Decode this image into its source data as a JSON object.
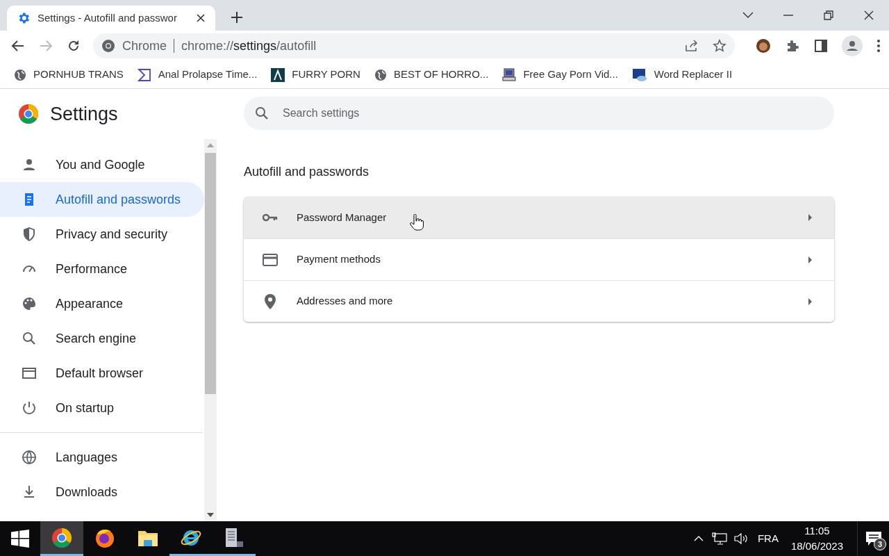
{
  "tab": {
    "title": "Settings - Autofill and passwor",
    "selected": true
  },
  "address_bar": {
    "site_label": "Chrome",
    "url_host": "chrome://",
    "url_path": "settings",
    "url_rest": "/autofill"
  },
  "bookmarks": [
    {
      "label": "PORNHUB TRANS"
    },
    {
      "label": "Anal Prolapse Time..."
    },
    {
      "label": "FURRY PORN"
    },
    {
      "label": "BEST OF HORRO..."
    },
    {
      "label": "Free Gay Porn Vid..."
    },
    {
      "label": "Word Replacer II"
    }
  ],
  "settings_title": "Settings",
  "search": {
    "placeholder": "Search settings"
  },
  "sidebar": {
    "groups": [
      [
        {
          "label": "You and Google",
          "selected": false
        },
        {
          "label": "Autofill and passwords",
          "selected": true
        },
        {
          "label": "Privacy and security",
          "selected": false
        },
        {
          "label": "Performance",
          "selected": false
        },
        {
          "label": "Appearance",
          "selected": false
        },
        {
          "label": "Search engine",
          "selected": false
        },
        {
          "label": "Default browser",
          "selected": false
        },
        {
          "label": "On startup",
          "selected": false
        }
      ],
      [
        {
          "label": "Languages",
          "selected": false
        },
        {
          "label": "Downloads",
          "selected": false
        }
      ]
    ]
  },
  "section_title": "Autofill and passwords",
  "rows": [
    {
      "label": "Password Manager",
      "highlighted": true
    },
    {
      "label": "Payment methods",
      "highlighted": false
    },
    {
      "label": "Addresses and more",
      "highlighted": false
    }
  ],
  "taskbar": {
    "apps": [
      {
        "selected": true,
        "running": true
      },
      {
        "selected": false,
        "running": false
      },
      {
        "selected": false,
        "running": false
      },
      {
        "selected": false,
        "running": true
      },
      {
        "selected": false,
        "running": true
      }
    ],
    "language": "FRA",
    "time": "11:05",
    "date": "18/06/2023",
    "notifications": "3"
  }
}
